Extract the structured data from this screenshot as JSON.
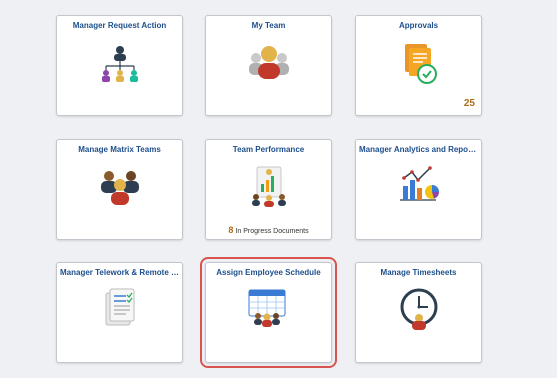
{
  "tiles": [
    {
      "title": "Manager Request Action",
      "icon": "org-chart-icon"
    },
    {
      "title": "My Team",
      "icon": "team-member-icon"
    },
    {
      "title": "Approvals",
      "icon": "approvals-document-icon",
      "count": "25"
    },
    {
      "title": "Manage Matrix Teams",
      "icon": "matrix-team-icon"
    },
    {
      "title": "Team Performance",
      "icon": "performance-document-icon",
      "footer_count": "8",
      "footer_text": "In Progress Documents"
    },
    {
      "title": "Manager Analytics and Reports",
      "icon": "analytics-chart-icon"
    },
    {
      "title": "Manager Telework & Remote W...",
      "icon": "checklist-document-icon"
    },
    {
      "title": "Assign Employee Schedule",
      "icon": "schedule-calendar-icon",
      "selected": true
    },
    {
      "title": "Manage Timesheets",
      "icon": "clock-person-icon"
    }
  ],
  "colors": {
    "title_blue": "#1d4f8c",
    "count_orange": "#b06a12",
    "highlight_red": "#d9534f",
    "person_red": "#c0392b",
    "person_brown": "#8a5a2b",
    "person_tan": "#e2b34a"
  }
}
